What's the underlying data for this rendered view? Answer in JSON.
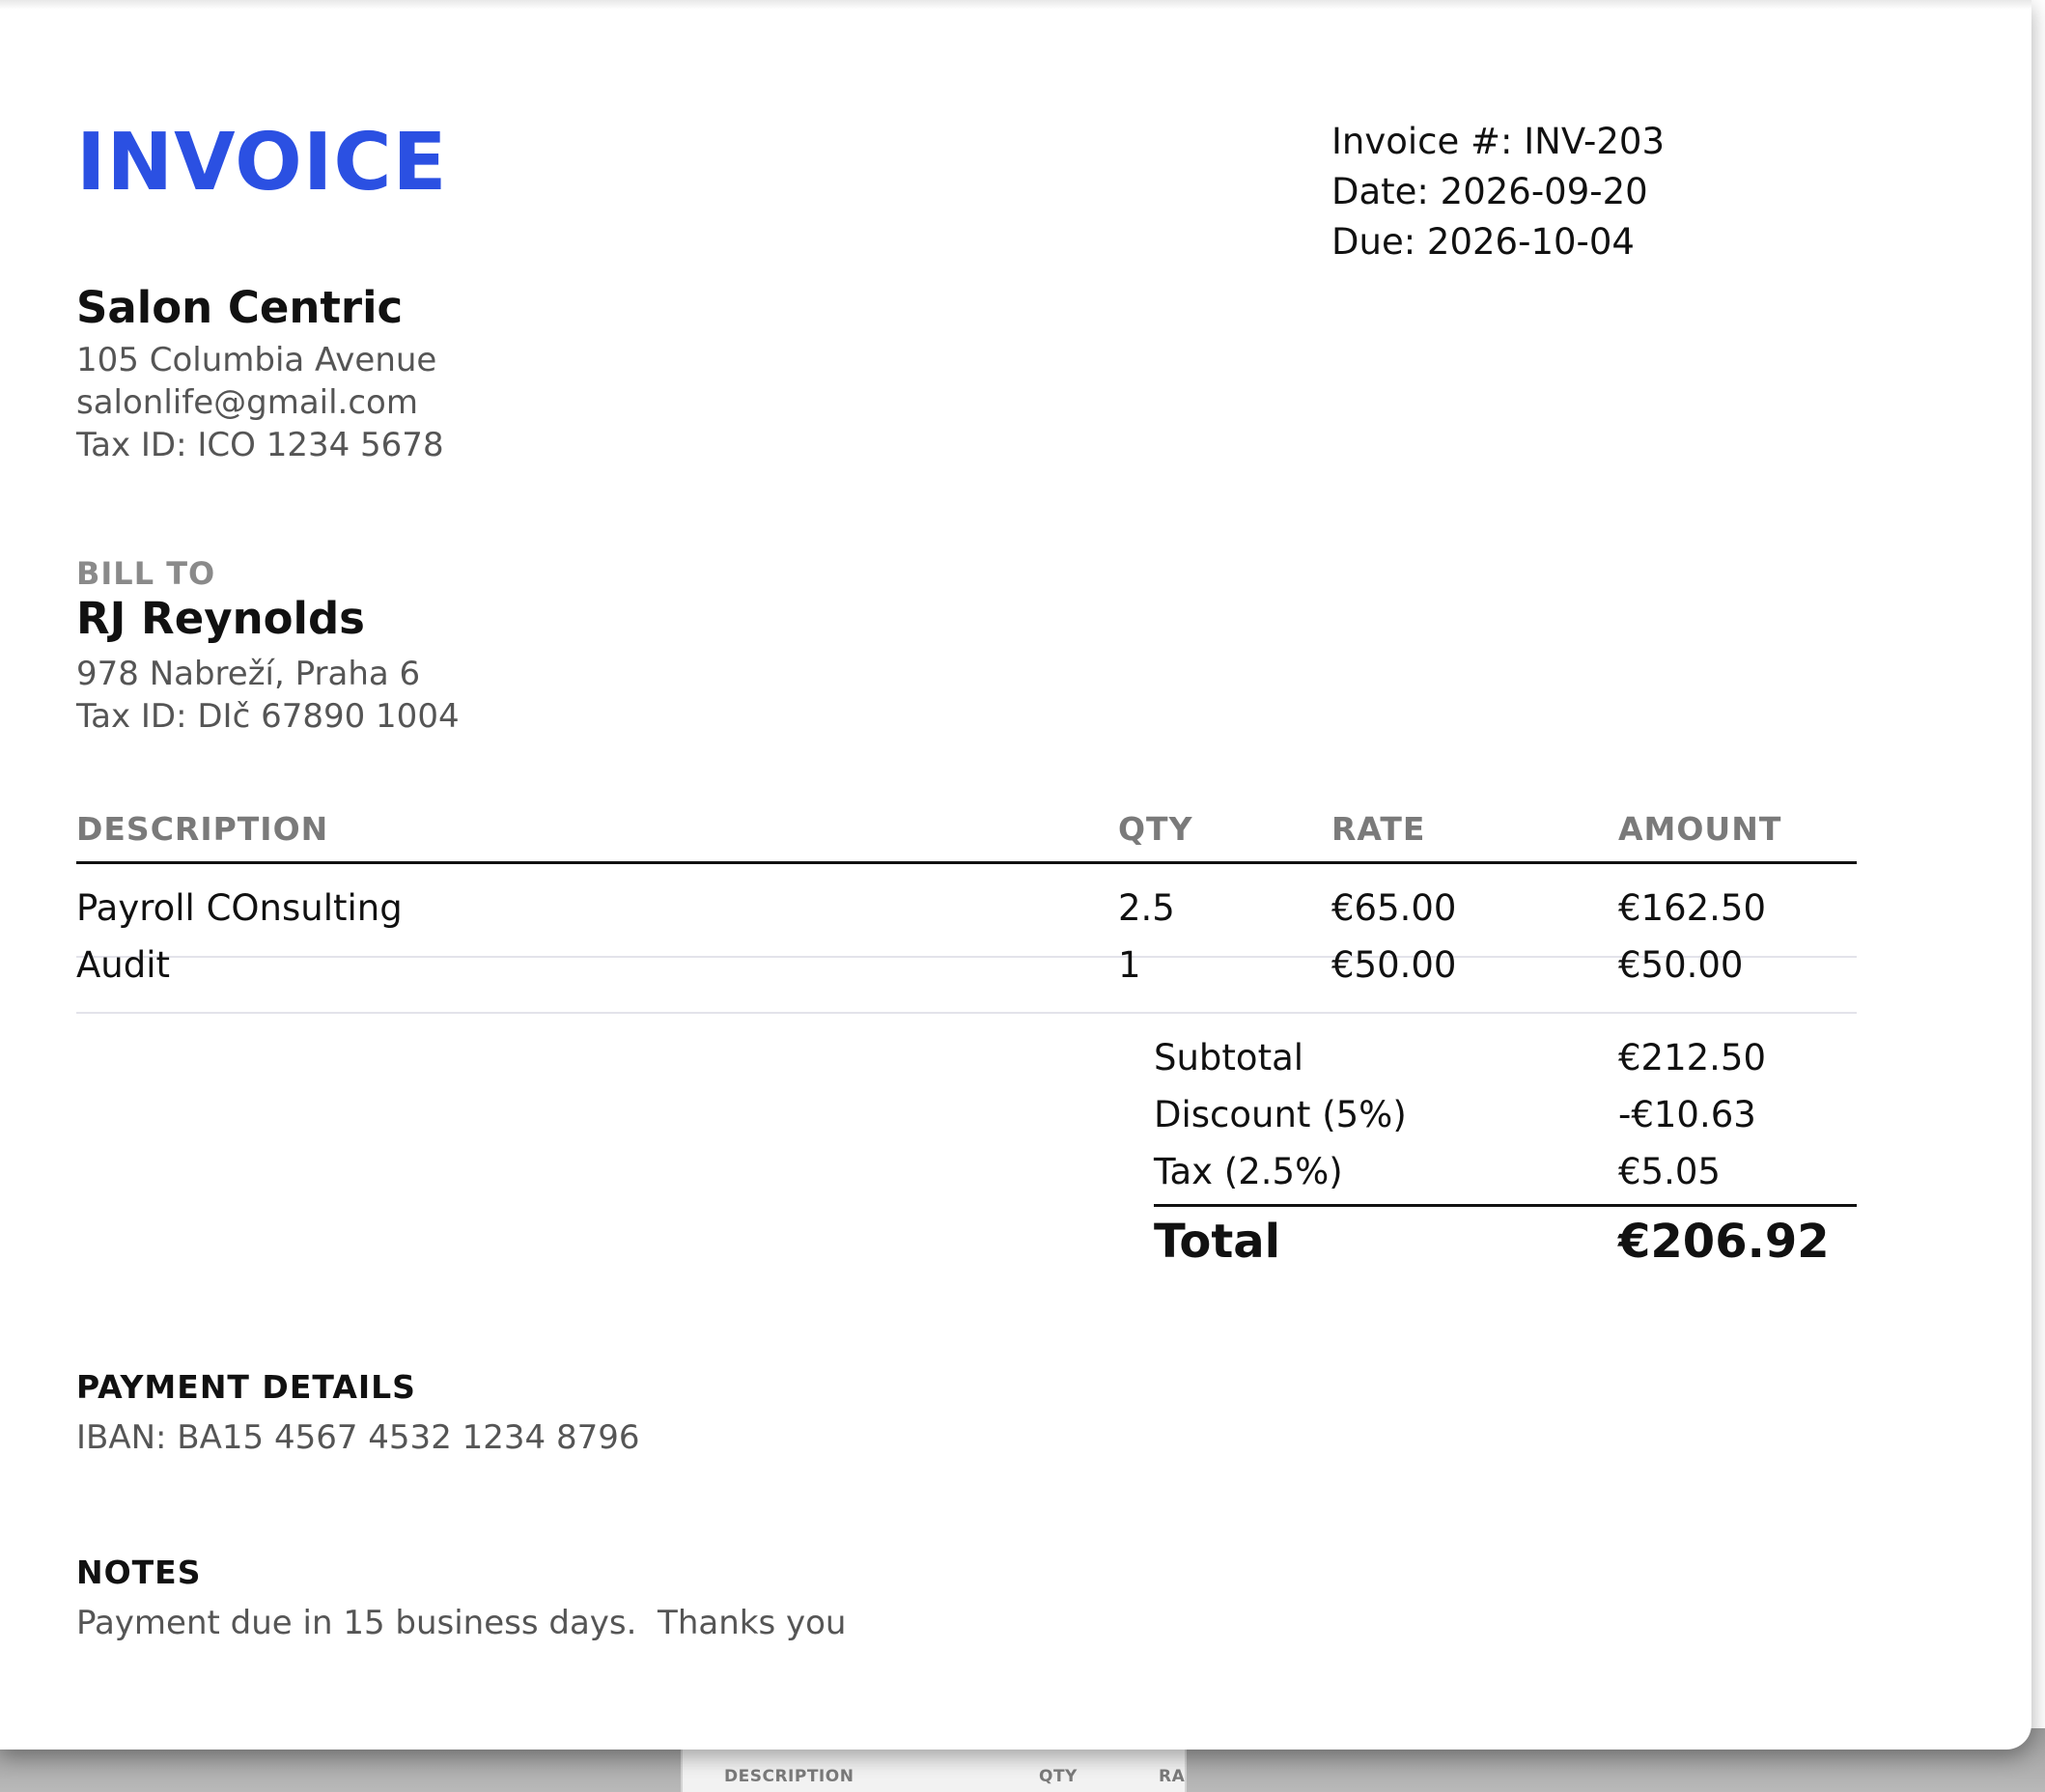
{
  "invoice": {
    "title": "INVOICE",
    "number_line": "Invoice #: INV-203",
    "date_line": "Date: 2026-09-20",
    "due_line": "Due: 2026-10-04"
  },
  "seller": {
    "name": "Salon Centric",
    "address": "105 Columbia Avenue",
    "email": "salonlife@gmail.com",
    "tax_id": "Tax ID: ICO 1234 5678"
  },
  "bill_to": {
    "heading": "BILL TO",
    "name": "RJ Reynolds",
    "address": "978 Nabreží, Praha 6",
    "tax_id": "Tax ID: DIč 67890 1004"
  },
  "table": {
    "headers": [
      "DESCRIPTION",
      "QTY",
      "RATE",
      "AMOUNT"
    ],
    "rows": [
      [
        "Payroll COnsulting",
        "2.5",
        "€65.00",
        "€162.50"
      ],
      [
        "Audit",
        "1",
        "€50.00",
        "€50.00"
      ]
    ]
  },
  "summary": {
    "subtotal_label": "Subtotal",
    "subtotal_value": "€212.50",
    "discount_label": "Discount (5%)",
    "discount_value": "-€10.63",
    "tax_label": "Tax (2.5%)",
    "tax_value": "€5.05",
    "total_label": "Total",
    "total_value": "€206.92"
  },
  "payment": {
    "heading": "PAYMENT DETAILS",
    "iban": "IBAN: BA15 4567 4532 1234 8796"
  },
  "notes": {
    "heading": "NOTES",
    "text": "Payment due in 15 business days.  Thanks you"
  },
  "background_doc": {
    "headers": [
      "DESCRIPTION",
      "QTY",
      "RA"
    ]
  },
  "colors": {
    "accent": "#2b50e2",
    "text": "#111111",
    "muted": "#555555",
    "header_gray": "#7a7a7a"
  }
}
